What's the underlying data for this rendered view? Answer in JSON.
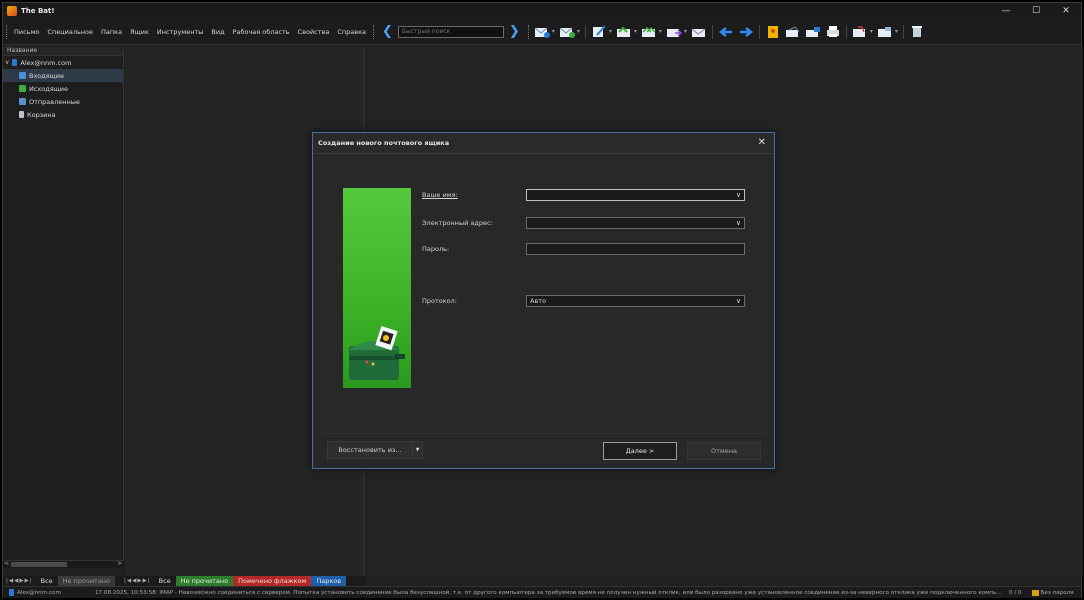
{
  "window": {
    "title": "The Bat!"
  },
  "menu": [
    "Письмо",
    "Специальное",
    "Папка",
    "Ящик",
    "Инструменты",
    "Вид",
    "Рабочая область",
    "Свойства",
    "Справка"
  ],
  "quick_search": {
    "placeholder": "Быстрый поиск"
  },
  "folder_pane": {
    "header": "Название",
    "account": "Alex@nnm.com",
    "folders": [
      "Входящие",
      "Исходящие",
      "Отправленные",
      "Корзина"
    ]
  },
  "tabs_left": [
    "Все",
    "Не прочитано"
  ],
  "tabs_right": [
    "Все",
    "Не прочитано",
    "Помечено флажком",
    "Парков"
  ],
  "status": {
    "account": "Alex@nnm.com",
    "message": "17.08.2025, 10:53:58: IMAP  - Невозможно соединиться с сервером. Попытка установить соединение была безуспешной, т.к. от другого компьютера за требуемое время не получен нужный отклик, или было разорвано уже установленное соединение из-за неверного отклика уже подключенного компь...",
    "count": "0 / 0",
    "password": "Без пароля"
  },
  "dialog": {
    "title": "Создание нового почтового ящика",
    "name_label": "Ваше имя:",
    "email_label": "Электронный адрес:",
    "password_label": "Пароль:",
    "protocol_label": "Протокол:",
    "name_value": "",
    "email_value": "",
    "password_value": "",
    "protocol_value": "Авто",
    "restore_button": "Восстановить из...",
    "next_button": "Далее  >",
    "cancel_button": "Отмена"
  }
}
